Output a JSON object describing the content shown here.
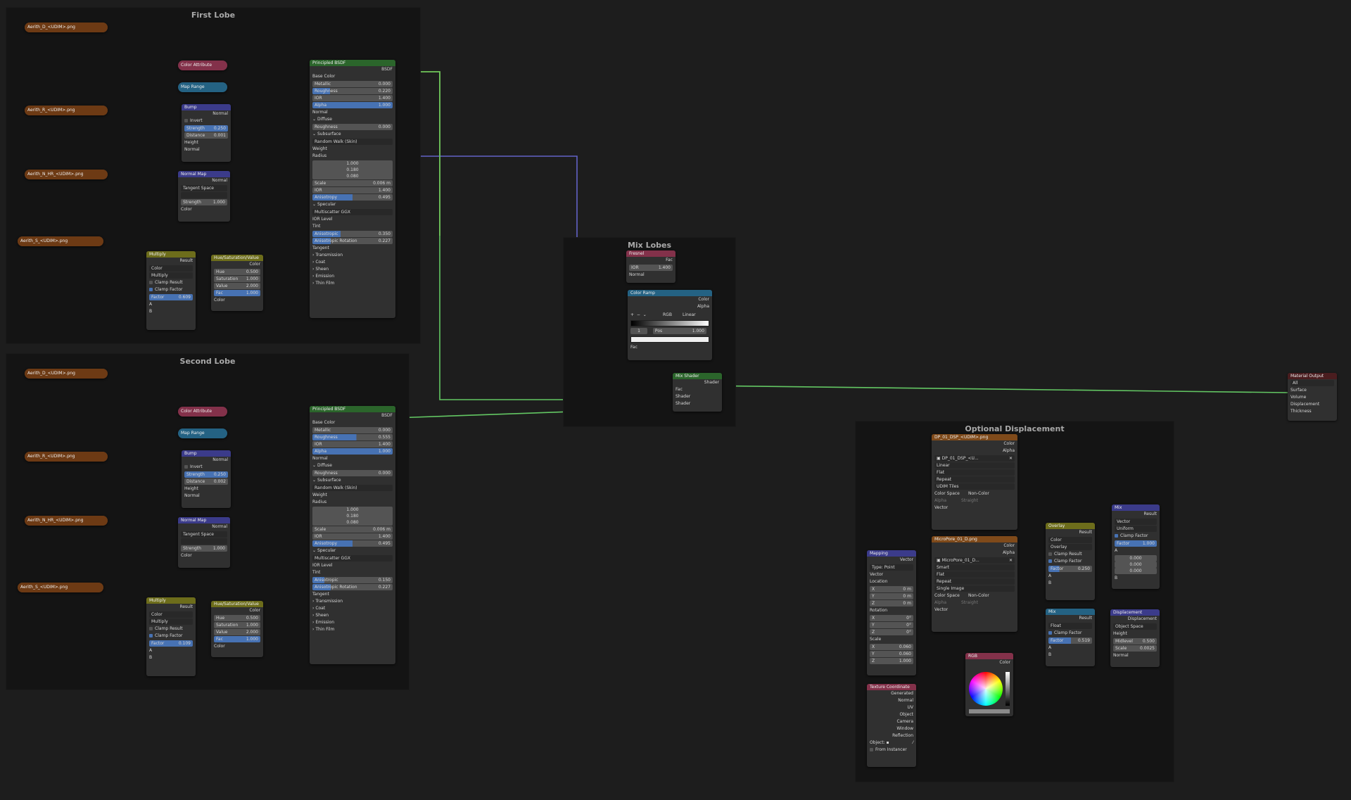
{
  "frames": {
    "first": "First Lobe",
    "second": "Second Lobe",
    "mix": "Mix Lobes",
    "disp": "Optional Displacement"
  },
  "lobe1": {
    "img_d": "Aerith_D_<UDIM>.png",
    "img_r": "Aerith_R_<UDIM>.png",
    "img_n": "Aerith_N_HR_<UDIM>.png",
    "img_s": "Aerith_S_<UDIM>.png",
    "color_attribute": "Color Attribute",
    "map_range": "Map Range",
    "bump": {
      "title": "Bump",
      "out": "Normal",
      "invert": "Invert",
      "strength_label": "Strength",
      "strength": "0.250",
      "distance_label": "Distance",
      "distance": "0.001",
      "height": "Height",
      "normal": "Normal"
    },
    "normal_map": {
      "title": "Normal Map",
      "out": "Normal",
      "space": "Tangent Space",
      "strength_label": "Strength",
      "strength": "1.000",
      "color": "Color"
    },
    "multiply": {
      "title": "Multiply",
      "out": "Result",
      "type": "Color",
      "mode": "Multiply",
      "clamp_result": "Clamp Result",
      "clamp_factor": "Clamp Factor",
      "factor_label": "Factor",
      "factor": "0.609",
      "a": "A",
      "b": "B"
    },
    "hsv": {
      "title": "Hue/Saturation/Value",
      "out": "Color",
      "hue_label": "Hue",
      "hue": "0.500",
      "sat_label": "Saturation",
      "sat": "1.000",
      "val_label": "Value",
      "val": "2.000",
      "fac_label": "Fac",
      "fac": "1.000",
      "color": "Color"
    },
    "bsdf": {
      "title": "Principled BSDF",
      "out": "BSDF",
      "base_color": "Base Color",
      "metallic_label": "Metallic",
      "metallic": "0.000",
      "roughness_label": "Roughness",
      "roughness": "0.220",
      "ior_label": "IOR",
      "ior": "1.400",
      "alpha_label": "Alpha",
      "alpha": "1.000",
      "normal": "Normal",
      "diffuse": "Diffuse",
      "d_roughness_label": "Roughness",
      "d_roughness": "0.000",
      "subsurface": "Subsurface",
      "method": "Random Walk (Skin)",
      "weight": "Weight",
      "radius": "Radius",
      "r1": "1.000",
      "r2": "0.180",
      "r3": "0.080",
      "scale_label": "Scale",
      "scale": "0.006 m",
      "sior_label": "IOR",
      "sior": "1.400",
      "aniso_label": "Anisotropy",
      "aniso": "0.495",
      "specular": "Specular",
      "dist": "Multiscatter GGX",
      "ior_level": "IOR Level",
      "tint": "Tint",
      "s_aniso_label": "Anisotropic",
      "s_aniso": "0.350",
      "rot_label": "Anisotropic Rotation",
      "rot": "0.227",
      "tangent": "Tangent",
      "transmission": "Transmission",
      "coat": "Coat",
      "sheen": "Sheen",
      "emission": "Emission",
      "thin_film": "Thin Film"
    }
  },
  "lobe2": {
    "img_d": "Aerith_D_<UDIM>.png",
    "img_r": "Aerith_R_<UDIM>.png",
    "img_n": "Aerith_N_HR_<UDIM>.png",
    "img_s": "Aerith_S_<UDIM>.png",
    "color_attribute": "Color Attribute",
    "map_range": "Map Range",
    "bump": {
      "title": "Bump",
      "out": "Normal",
      "invert": "Invert",
      "strength_label": "Strength",
      "strength": "0.250",
      "distance_label": "Distance",
      "distance": "0.002",
      "height": "Height",
      "normal": "Normal"
    },
    "normal_map": {
      "title": "Normal Map",
      "out": "Normal",
      "space": "Tangent Space",
      "strength_label": "Strength",
      "strength": "1.000",
      "color": "Color"
    },
    "multiply": {
      "title": "Multiply",
      "out": "Result",
      "type": "Color",
      "mode": "Multiply",
      "clamp_result": "Clamp Result",
      "clamp_factor": "Clamp Factor",
      "factor_label": "Factor",
      "factor": "0.109",
      "a": "A",
      "b": "B"
    },
    "hsv": {
      "title": "Hue/Saturation/Value",
      "out": "Color",
      "hue_label": "Hue",
      "hue": "0.500",
      "sat_label": "Saturation",
      "sat": "1.000",
      "val_label": "Value",
      "val": "2.000",
      "fac_label": "Fac",
      "fac": "1.000",
      "color": "Color"
    },
    "bsdf": {
      "title": "Principled BSDF",
      "out": "BSDF",
      "base_color": "Base Color",
      "metallic_label": "Metallic",
      "metallic": "0.000",
      "roughness_label": "Roughness",
      "roughness": "0.555",
      "ior_label": "IOR",
      "ior": "1.400",
      "alpha_label": "Alpha",
      "alpha": "1.000",
      "normal": "Normal",
      "diffuse": "Diffuse",
      "d_roughness_label": "Roughness",
      "d_roughness": "0.000",
      "subsurface": "Subsurface",
      "method": "Random Walk (Skin)",
      "weight": "Weight",
      "radius": "Radius",
      "r1": "1.000",
      "r2": "0.180",
      "r3": "0.080",
      "scale_label": "Scale",
      "scale": "0.006 m",
      "sior_label": "IOR",
      "sior": "1.400",
      "aniso_label": "Anisotropy",
      "aniso": "0.495",
      "specular": "Specular",
      "dist": "Multiscatter GGX",
      "ior_level": "IOR Level",
      "tint": "Tint",
      "s_aniso_label": "Anisotropic",
      "s_aniso": "0.150",
      "rot_label": "Anisotropic Rotation",
      "rot": "0.227",
      "tangent": "Tangent",
      "transmission": "Transmission",
      "coat": "Coat",
      "sheen": "Sheen",
      "emission": "Emission",
      "thin_film": "Thin Film"
    }
  },
  "mix": {
    "fresnel": {
      "title": "Fresnel",
      "out": "Fac",
      "ior_label": "IOR",
      "ior": "1.400",
      "normal": "Normal"
    },
    "ramp": {
      "title": "Color Ramp",
      "out_color": "Color",
      "out_alpha": "Alpha",
      "mode": "RGB",
      "interp": "Linear",
      "index": "1",
      "pos_label": "Pos",
      "pos": "1.000",
      "fac": "Fac"
    },
    "mix_shader": {
      "title": "Mix Shader",
      "out": "Shader",
      "fac": "Fac",
      "s1": "Shader",
      "s2": "Shader"
    }
  },
  "output": {
    "title": "Material Output",
    "target": "All",
    "surface": "Surface",
    "volume": "Volume",
    "displacement": "Displacement",
    "thickness": "Thickness"
  },
  "disp": {
    "tex1": {
      "title": "DP_01_DSP_<UDIM>.png",
      "color": "Color",
      "alpha": "Alpha",
      "file": "DP_01_DSP_<U...",
      "interp": "Linear",
      "proj": "Flat",
      "ext": "Repeat",
      "source": "UDIM Tiles",
      "cs_label": "Color Space",
      "cs": "Non-Color",
      "alpha_label": "Alpha",
      "alpha_val": "Straight",
      "vector": "Vector"
    },
    "tex2": {
      "title": "MicroPore_01_D.png",
      "color": "Color",
      "alpha": "Alpha",
      "file": "MicroPore_01_D...",
      "interp": "Smart",
      "proj": "Flat",
      "ext": "Repeat",
      "source": "Single Image",
      "cs_label": "Color Space",
      "cs": "Non-Color",
      "alpha_label": "Alpha",
      "alpha_val": "Straight",
      "vector": "Vector"
    },
    "mapping": {
      "title": "Mapping",
      "out": "Vector",
      "type_label": "Type:",
      "type": "Point",
      "vector": "Vector",
      "location": "Location",
      "lx": "0 m",
      "ly": "0 m",
      "lz": "0 m",
      "rotation": "Rotation",
      "rx": "0°",
      "ry": "0°",
      "rz": "0°",
      "scale": "Scale",
      "sx": "0.060",
      "sy": "0.060",
      "sz": "1.000",
      "x": "X",
      "y": "Y",
      "z": "Z"
    },
    "texcoord": {
      "title": "Texture Coordinate",
      "generated": "Generated",
      "normal": "Normal",
      "uv": "UV",
      "object": "Object",
      "camera": "Camera",
      "window": "Window",
      "reflection": "Reflection",
      "object_label": "Object:",
      "from_instancer": "From Instancer"
    },
    "rgb": {
      "title": "RGB",
      "out": "Color"
    },
    "overlay": {
      "title": "Overlay",
      "out": "Result",
      "type": "Color",
      "mode": "Overlay",
      "clamp_result": "Clamp Result",
      "clamp_factor": "Clamp Factor",
      "factor_label": "Factor",
      "factor": "0.250",
      "a": "A",
      "b": "B"
    },
    "mix_float": {
      "title": "Mix",
      "out": "Result",
      "type": "Float",
      "clamp_factor": "Clamp Factor",
      "factor_label": "Factor",
      "factor": "0.519",
      "a": "A",
      "b": "B"
    },
    "mix_vec": {
      "title": "Mix",
      "out": "Result",
      "type": "Vector",
      "mode": "Uniform",
      "clamp_factor": "Clamp Factor",
      "factor_label": "Factor",
      "factor": "1.000",
      "a": "A",
      "v1": "0.000",
      "v2": "0.000",
      "v3": "0.000",
      "b": "B"
    },
    "displacement": {
      "title": "Displacement",
      "out": "Displacement",
      "space": "Object Space",
      "height": "Height",
      "mid_label": "Midlevel",
      "mid": "0.500",
      "scale_label": "Scale",
      "scale": "0.0025",
      "normal": "Normal"
    }
  },
  "colors": {
    "image_header": "#6d3a14",
    "shader_header": "#2b652b",
    "vector_header": "#3b3b8a",
    "converter_header": "#246283",
    "input_header": "#83314a",
    "color_header": "#6d6d1b",
    "wire_color": "#c7c729",
    "wire_vector": "#6363c7",
    "wire_shader": "#63c763"
  }
}
